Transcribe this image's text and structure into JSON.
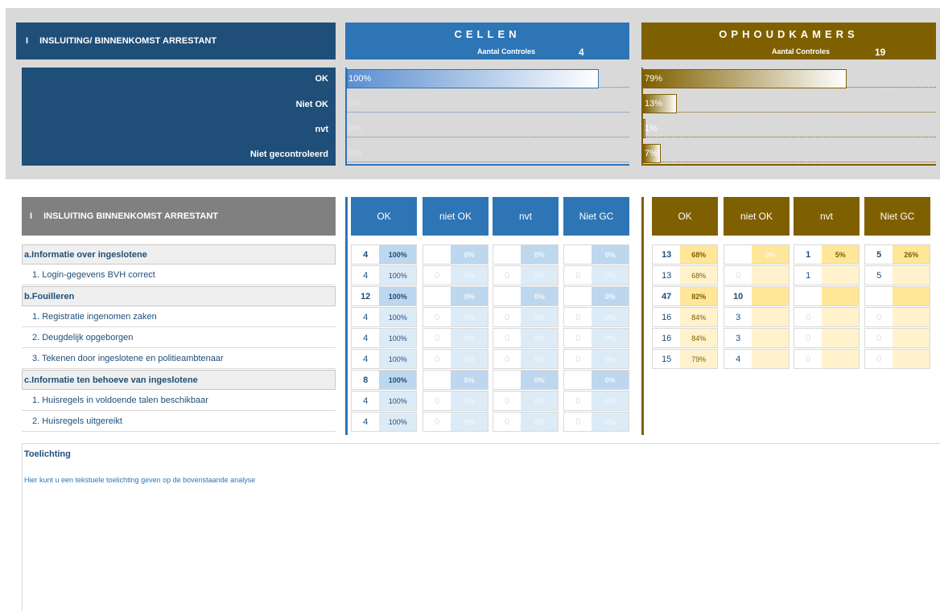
{
  "summary": {
    "title_roman": "I",
    "title": "INSLUITING/ BINNENKOMST ARRESTANT",
    "row_labels": [
      "OK",
      "Niet OK",
      "nvt",
      "Niet gecontroleerd"
    ],
    "cellen": {
      "title": "CELLEN",
      "controls_label": "Aantal Controles",
      "controls_count": "4",
      "bars": [
        {
          "label": "100%",
          "fraction": 1.0
        },
        {
          "label": "0%",
          "fraction": 0.0
        },
        {
          "label": "0%",
          "fraction": 0.0
        },
        {
          "label": "0%",
          "fraction": 0.0
        }
      ]
    },
    "ophoudkamers": {
      "title": "OPHOUDKAMERS",
      "controls_label": "Aantal Controles",
      "controls_count": "19",
      "bars": [
        {
          "label": "79%",
          "fraction": 0.79
        },
        {
          "label": "13%",
          "fraction": 0.13
        },
        {
          "label": "1%",
          "fraction": 0.01
        },
        {
          "label": "7%",
          "fraction": 0.07
        }
      ]
    }
  },
  "detail": {
    "title_roman": "I",
    "title": "INSLUITING BINNENKOMST ARRESTANT",
    "columns": [
      "OK",
      "niet OK",
      "nvt",
      "Niet GC"
    ],
    "rows": [
      {
        "label": "a.Informatie over ingeslotene",
        "type": "cat",
        "cel": [
          [
            "4",
            "100%"
          ],
          [
            "",
            "0%"
          ],
          [
            "",
            "0%"
          ],
          [
            "",
            "0%"
          ]
        ],
        "oph": [
          [
            "13",
            "68%"
          ],
          [
            "",
            "0%"
          ],
          [
            "1",
            "5%"
          ],
          [
            "5",
            "26%"
          ]
        ]
      },
      {
        "label": "1. Login-gegevens BVH correct",
        "type": "sub",
        "cel": [
          [
            "4",
            "100%"
          ],
          [
            "0",
            "0%"
          ],
          [
            "0",
            "0%"
          ],
          [
            "0",
            "0%"
          ]
        ],
        "oph": [
          [
            "13",
            "68%"
          ],
          [
            "0",
            ""
          ],
          [
            "1",
            ""
          ],
          [
            "5",
            ""
          ]
        ]
      },
      {
        "label": "b.Fouilleren",
        "type": "cat",
        "cel": [
          [
            "12",
            "100%"
          ],
          [
            "",
            "0%"
          ],
          [
            "",
            "0%"
          ],
          [
            "",
            "0%"
          ]
        ],
        "oph": [
          [
            "47",
            "82%"
          ],
          [
            "10",
            ""
          ],
          [
            "",
            ""
          ],
          [
            "",
            ""
          ]
        ]
      },
      {
        "label": "1. Registratie ingenomen zaken",
        "type": "sub",
        "cel": [
          [
            "4",
            "100%"
          ],
          [
            "0",
            "0%"
          ],
          [
            "0",
            "0%"
          ],
          [
            "0",
            "0%"
          ]
        ],
        "oph": [
          [
            "16",
            "84%"
          ],
          [
            "3",
            ""
          ],
          [
            "0",
            ""
          ],
          [
            "0",
            ""
          ]
        ]
      },
      {
        "label": "2. Deugdelijk opgeborgen",
        "type": "sub",
        "cel": [
          [
            "4",
            "100%"
          ],
          [
            "0",
            "0%"
          ],
          [
            "0",
            "0%"
          ],
          [
            "0",
            "0%"
          ]
        ],
        "oph": [
          [
            "16",
            "84%"
          ],
          [
            "3",
            ""
          ],
          [
            "0",
            ""
          ],
          [
            "0",
            ""
          ]
        ]
      },
      {
        "label": "3. Tekenen door ingeslotene en politieambtenaar",
        "type": "sub",
        "cel": [
          [
            "4",
            "100%"
          ],
          [
            "0",
            "0%"
          ],
          [
            "0",
            "0%"
          ],
          [
            "0",
            "0%"
          ]
        ],
        "oph": [
          [
            "15",
            "79%"
          ],
          [
            "4",
            ""
          ],
          [
            "0",
            ""
          ],
          [
            "0",
            ""
          ]
        ]
      },
      {
        "label": "c.Informatie ten behoeve van ingeslotene",
        "type": "cat",
        "cel": [
          [
            "8",
            "100%"
          ],
          [
            "",
            "0%"
          ],
          [
            "",
            "0%"
          ],
          [
            "",
            "0%"
          ]
        ],
        "oph": null
      },
      {
        "label": "1. Huisregels in voldoende talen beschikbaar",
        "type": "sub",
        "cel": [
          [
            "4",
            "100%"
          ],
          [
            "0",
            "0%"
          ],
          [
            "0",
            "0%"
          ],
          [
            "0",
            "0%"
          ]
        ],
        "oph": null
      },
      {
        "label": "2. Huisregels uitgereikt",
        "type": "sub",
        "cel": [
          [
            "4",
            "100%"
          ],
          [
            "0",
            "0%"
          ],
          [
            "0",
            "0%"
          ],
          [
            "0",
            "0%"
          ]
        ],
        "oph": null
      }
    ]
  },
  "toelichting": {
    "title": "Toelichting",
    "placeholder": "Hier kunt u een tekstuele toelichting geven op de bovenstaande analyse"
  },
  "colors": {
    "cellen": "#2e75b6",
    "ophoudkamers": "#7f6000",
    "header_dark": "#1f4e79"
  }
}
